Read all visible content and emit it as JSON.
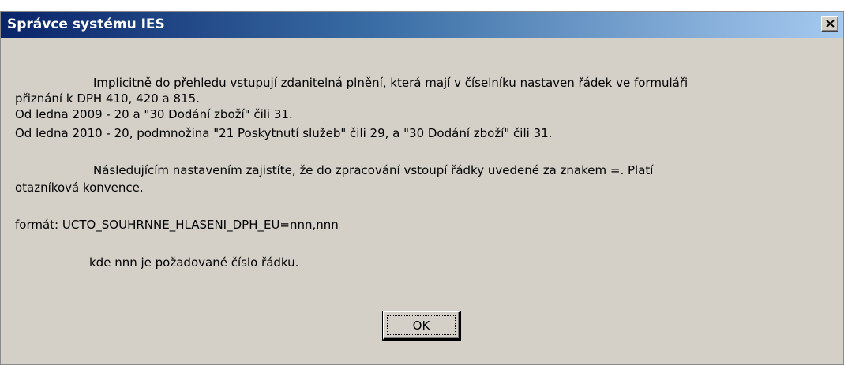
{
  "window": {
    "title": "Správce systému IES",
    "close_icon": "close-icon"
  },
  "message": {
    "p1_line1": "Implicitně do přehledu vstupují zdanitelná plnění, která mají v číselníku nastaven řádek ve formuláři",
    "p1_line2": "přiznání k DPH 410, 420 a 815.",
    "p1_line3": "Od ledna 2009 - 20 a \"30 Dodání zboží\" čili 31.",
    "p1_line4": "Od ledna 2010 - 20, podmnožina \"21 Poskytnutí služeb\" čili 29, a \"30 Dodání zboží\" čili 31.",
    "p2_line1": "Následujícím nastavením zajistíte, že do zpracování vstoupí řádky uvedené za znakem =. Platí",
    "p2_line2": "otazníková konvence.",
    "format_line": "formát: UCTO_SOUHRNNE_HLASENI_DPH_EU=nnn,nnn",
    "note_line": "kde nnn je požadované číslo řádku."
  },
  "buttons": {
    "ok_label": "OK"
  }
}
